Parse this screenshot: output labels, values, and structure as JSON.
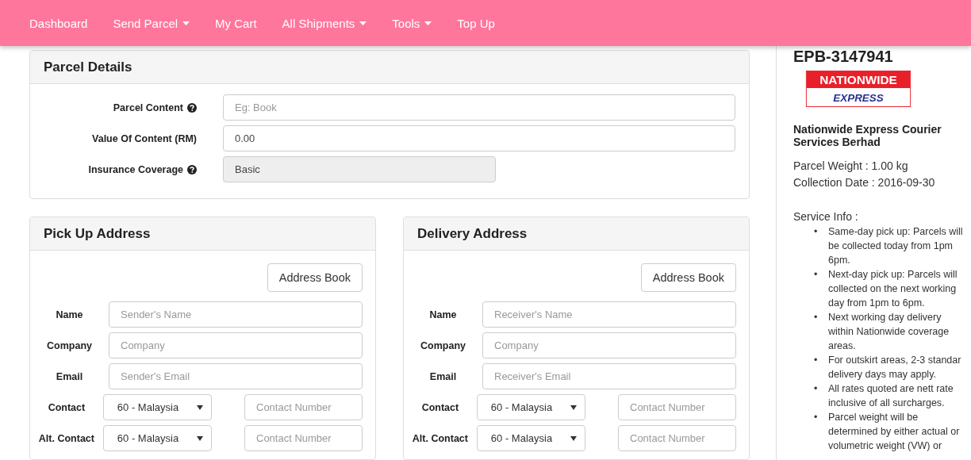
{
  "nav": {
    "items": [
      {
        "label": "Dashboard",
        "dropdown": false
      },
      {
        "label": "Send Parcel",
        "dropdown": true
      },
      {
        "label": "My Cart",
        "dropdown": false
      },
      {
        "label": "All Shipments",
        "dropdown": true
      },
      {
        "label": "Tools",
        "dropdown": true
      },
      {
        "label": "Top Up",
        "dropdown": false
      }
    ]
  },
  "parcel_details": {
    "title": "Parcel Details",
    "fields": [
      {
        "label": "Parcel Content",
        "help": true,
        "placeholder": "Eg: Book",
        "disabled": false
      },
      {
        "label": "Value Of Content (RM)",
        "help": false,
        "value": "0.00",
        "disabled": false
      },
      {
        "label": "Insurance Coverage",
        "help": true,
        "value": "Basic",
        "disabled": true
      }
    ]
  },
  "addresses": [
    {
      "title": "Pick Up Address",
      "address_book": "Address Book",
      "fields": [
        {
          "kind": "text",
          "label": "Name",
          "placeholder": "Sender's Name"
        },
        {
          "kind": "text",
          "label": "Company",
          "placeholder": "Company"
        },
        {
          "kind": "text",
          "label": "Email",
          "placeholder": "Sender's Email"
        },
        {
          "kind": "phone",
          "label": "Contact",
          "country": "60 - Malaysia",
          "placeholder": "Contact Number"
        },
        {
          "kind": "phone",
          "label": "Alt. Contact",
          "country": "60 - Malaysia",
          "placeholder": "Contact Number"
        }
      ]
    },
    {
      "title": "Delivery Address",
      "address_book": "Address Book",
      "fields": [
        {
          "kind": "text",
          "label": "Name",
          "placeholder": "Receiver's Name"
        },
        {
          "kind": "text",
          "label": "Company",
          "placeholder": "Company"
        },
        {
          "kind": "text",
          "label": "Email",
          "placeholder": "Receiver's Email"
        },
        {
          "kind": "phone",
          "label": "Contact",
          "country": "60 - Malaysia",
          "placeholder": "Contact Number"
        },
        {
          "kind": "phone",
          "label": "Alt. Contact",
          "country": "60 - Malaysia",
          "placeholder": "Contact Number"
        }
      ]
    }
  ],
  "summary": {
    "reference": "EPB-3147941",
    "logo": {
      "top": "NATIONWIDE",
      "bottom": "EXPRESS"
    },
    "courier": "Nationwide Express Courier Services Berhad",
    "details": [
      "Parcel Weight : 1.00 kg",
      "Collection Date : 2016-09-30"
    ],
    "service_info": {
      "title": "Service Info :",
      "bullet": "•",
      "items": [
        {
          "lines": [
            "Same-day pick up: Parcels will",
            "be collected today from 1pm",
            "6pm."
          ]
        },
        {
          "lines": [
            "Next-day pick up: Parcels will",
            "collected on the next working",
            "day from 1pm to 6pm."
          ]
        },
        {
          "lines": [
            "Next working day delivery",
            "within Nationwide coverage",
            "areas."
          ]
        },
        {
          "lines": [
            "For outskirt areas, 2-3 standar",
            "delivery days may apply."
          ]
        },
        {
          "lines": [
            "All rates quoted are nett rate",
            "inclusive of all surcharges."
          ]
        },
        {
          "lines": [
            "Parcel weight will be",
            "determined by either actual or",
            "volumetric weight (VW) or"
          ]
        }
      ]
    }
  }
}
